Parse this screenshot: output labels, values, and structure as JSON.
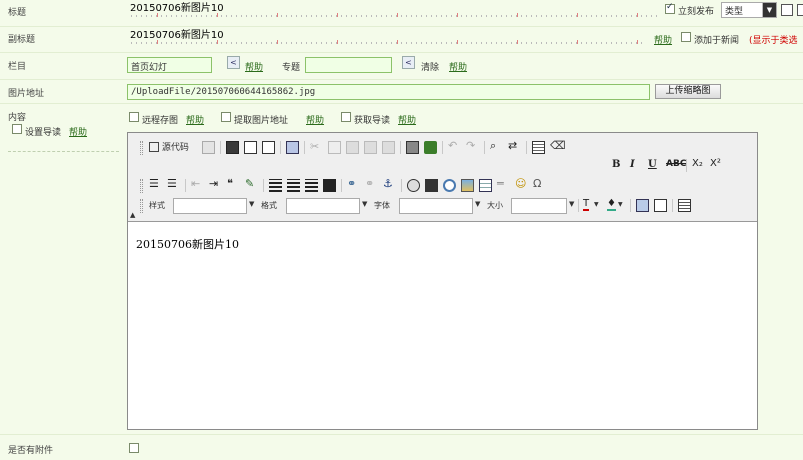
{
  "fields": {
    "title": {
      "label": "标题",
      "value": "20150706新图片10"
    },
    "subtitle": {
      "label": "副标题",
      "value": "20150706新图片10"
    },
    "column": {
      "label": "栏目",
      "value": "首页幻灯",
      "help": "帮助",
      "special_label": "专题",
      "special_value": "",
      "clear": "清除",
      "help2": "帮助"
    },
    "image": {
      "label": "图片地址",
      "value": "/UploadFile/201507060644165862.jpg",
      "upload_button": "上传缩略图"
    },
    "content": {
      "label": "内容",
      "set_intro": "设置导读",
      "help": "帮助",
      "remote_save": "远程存图",
      "remote_help": "帮助",
      "extract_image": "提取图片地址",
      "extract_help": "帮助",
      "get_intro": "获取导读",
      "get_help": "帮助"
    },
    "attachment": {
      "label": "是否有附件"
    }
  },
  "title_options": {
    "publish_now": "立刻发布",
    "publish_checked": true,
    "type_select": "类型"
  },
  "subtitle_options": {
    "help": "帮助",
    "add_news": "添加于新闻",
    "note": "(显示于类选"
  },
  "editor": {
    "source_code": "源代码",
    "style_label": "样式",
    "format_label": "格式",
    "font_label": "字体",
    "size_label": "大小",
    "content": "20150706新图片10"
  },
  "colors": {
    "background": "#f4fbea",
    "link": "#2b6b1b",
    "note": "#d00000",
    "green_border": "#8cc26a"
  }
}
